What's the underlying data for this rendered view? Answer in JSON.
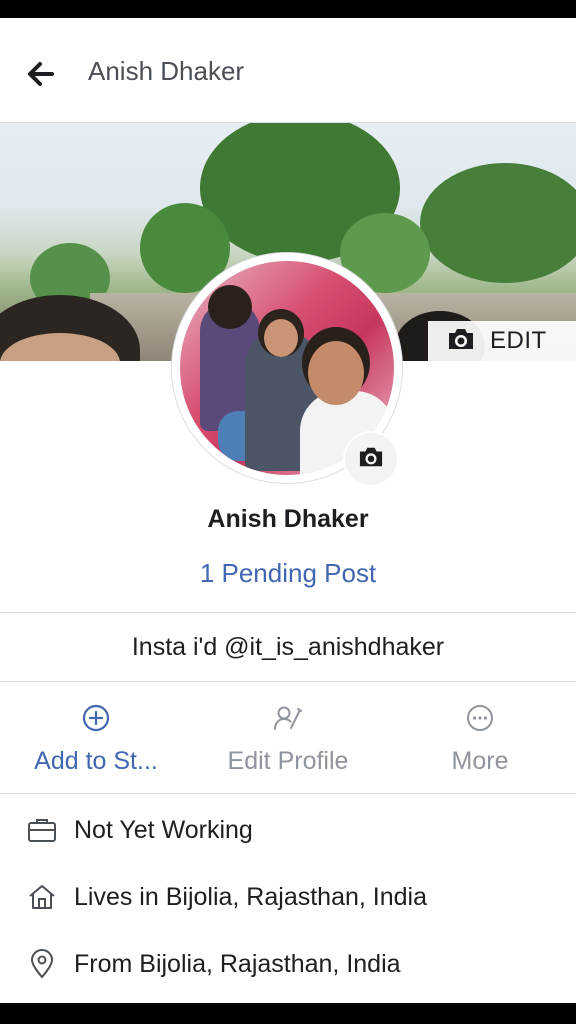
{
  "header": {
    "title": "Anish Dhaker"
  },
  "cover": {
    "edit_label": "EDIT"
  },
  "profile": {
    "name": "Anish Dhaker",
    "pending": "1 Pending Post",
    "bio": "Insta i'd @it_is_anishdhaker"
  },
  "actions": [
    {
      "label": "Add to St...",
      "icon": "add-circle-icon"
    },
    {
      "label": "Edit Profile",
      "icon": "edit-profile-icon"
    },
    {
      "label": "More",
      "icon": "more-icon"
    }
  ],
  "info": [
    {
      "text": "Not Yet Working",
      "icon": "briefcase-icon"
    },
    {
      "text": "Lives in Bijolia, Rajasthan, India",
      "icon": "home-icon"
    },
    {
      "text": "From Bijolia, Rajasthan, India",
      "icon": "location-pin-icon"
    }
  ],
  "colors": {
    "link": "#4267b2",
    "muted": "#90949c",
    "divider": "#dadde1"
  }
}
